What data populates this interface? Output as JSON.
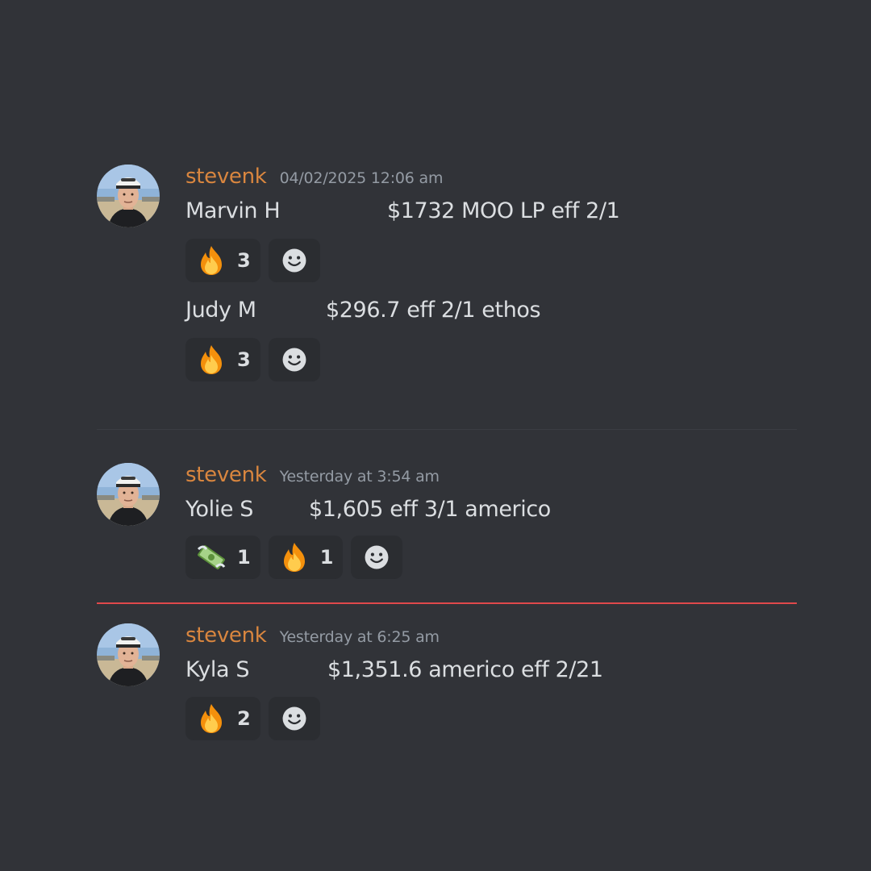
{
  "messages": [
    {
      "username": "stevenk",
      "timestamp": "04/02/2025 12:06 am",
      "lines": [
        {
          "name": "Marvin H",
          "text": "$1732 MOO LP eff 2/1",
          "reactions": [
            {
              "emoji": "fire-emoji",
              "count": "3"
            }
          ]
        },
        {
          "name": "Judy M",
          "text": "$296.7 eff 2/1 ethos",
          "reactions": [
            {
              "emoji": "fire-emoji",
              "count": "3"
            }
          ]
        }
      ]
    },
    {
      "username": "stevenk",
      "timestamp": "Yesterday at 3:54 am",
      "lines": [
        {
          "name": "Yolie S",
          "text": "$1,605 eff 3/1 americo",
          "reactions": [
            {
              "emoji": "money-with-wings-emoji",
              "count": "1"
            },
            {
              "emoji": "fire-emoji",
              "count": "1"
            }
          ]
        }
      ]
    },
    {
      "username": "stevenk",
      "timestamp": "Yesterday at 6:25 am",
      "lines": [
        {
          "name": "Kyla S",
          "text": "$1,351.6 americo eff 2/21",
          "reactions": [
            {
              "emoji": "fire-emoji",
              "count": "2"
            }
          ]
        }
      ]
    }
  ],
  "add_reaction_icon": "smiley-add-reaction-icon",
  "colors": {
    "background": "#313338",
    "username": "#d9863f",
    "timestamp": "#949ba4",
    "text": "#dbdee1",
    "reaction_bg": "#2b2d31",
    "new_messages_divider": "#e0494b"
  }
}
